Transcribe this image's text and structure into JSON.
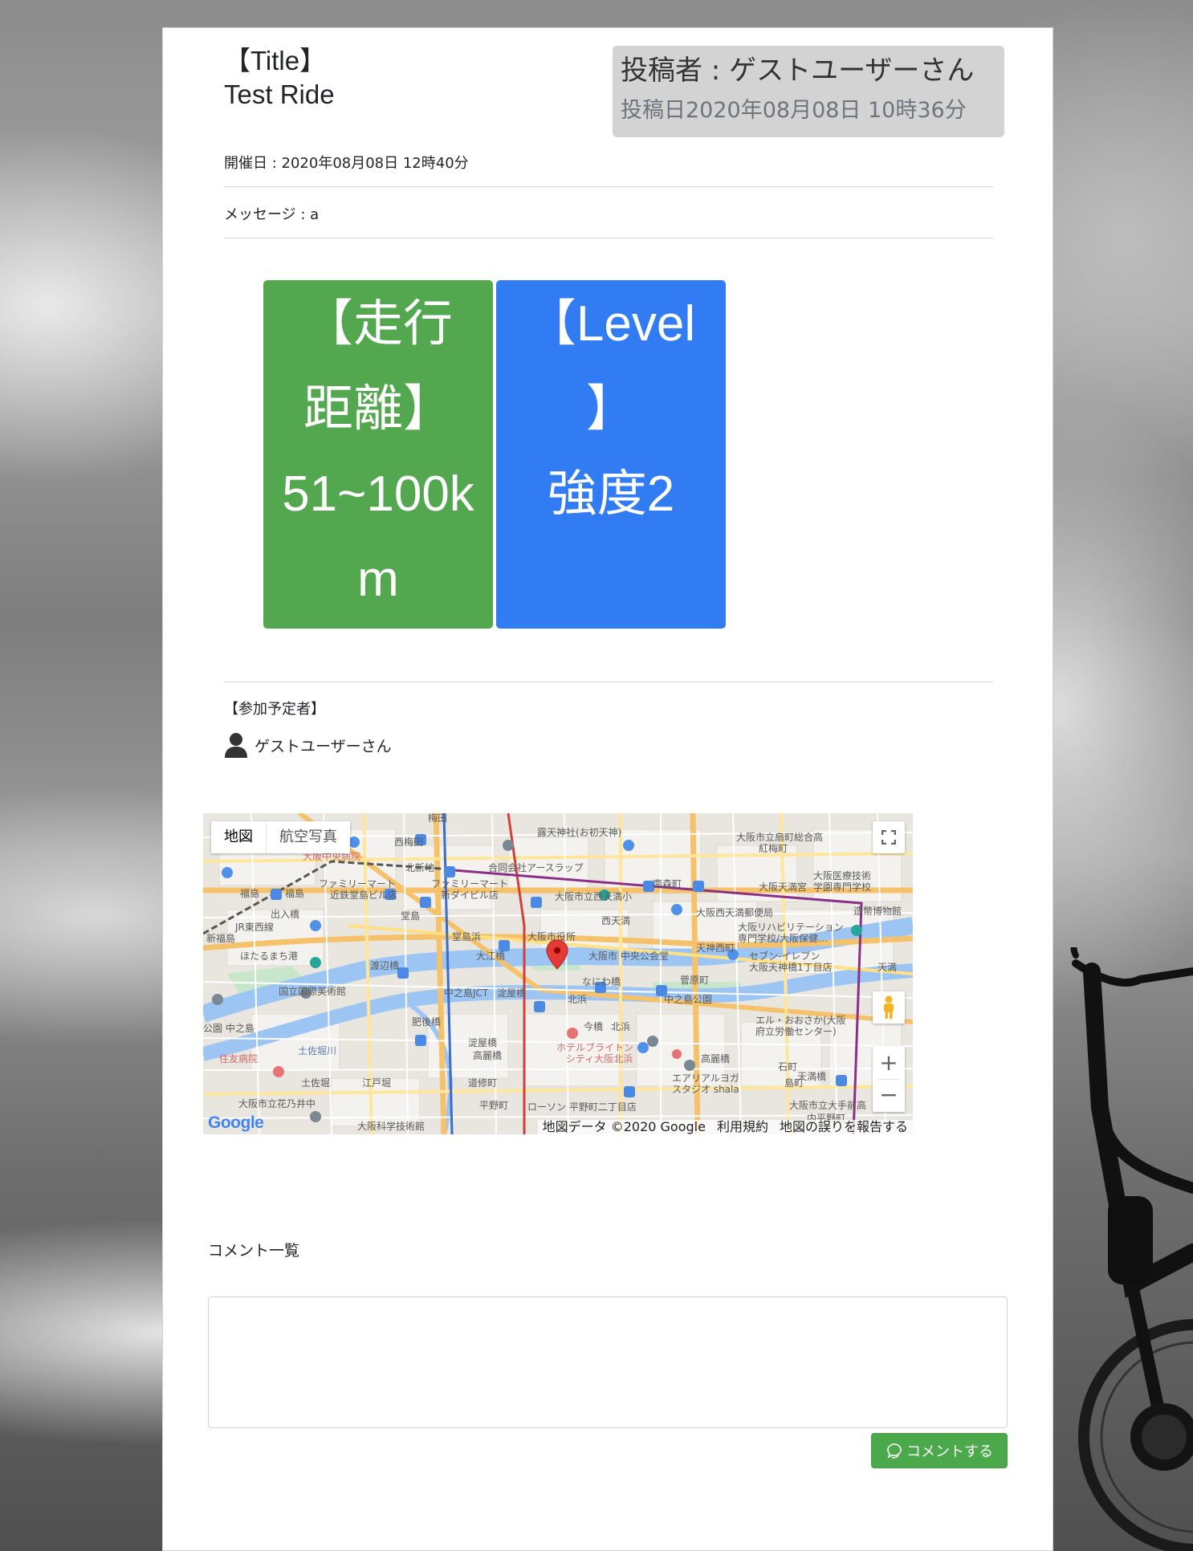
{
  "post": {
    "title_label": "【Title】",
    "title": "Test Ride",
    "author": "投稿者 : ゲストユーザーさん",
    "posted_at": "投稿日2020年08月08日 10時36分",
    "event_date": "開催日 : 2020年08月08日 12時40分",
    "message": "メッセージ : a"
  },
  "tiles": {
    "distance": {
      "line1": "【走行",
      "line2": "距離】",
      "line3": "51~100k",
      "line4": "m",
      "color": "#53a74e"
    },
    "level": {
      "line1": "【Level",
      "line2": "】",
      "line3": "強度2",
      "color": "#327cf3"
    }
  },
  "participants": {
    "heading": "【参加予定者】",
    "users": [
      "ゲストユーザーさん"
    ]
  },
  "map": {
    "type_map": "地図",
    "type_satellite": "航空写真",
    "zoom_in": "+",
    "zoom_out": "−",
    "logo": "Google",
    "attribution": "地図データ ©2020 Google",
    "terms": "利用規約",
    "report": "地図の誤りを報告する",
    "labels": [
      "梅田",
      "西梅田",
      "大阪中央病院",
      "露天神社(お初天神)",
      "大阪市立扇町総合高",
      "北新地",
      "合同会社アースラップ",
      "福島",
      "ファミリーマート 近鉄堂島ビル店",
      "ファミリーマート 新ダイビル店",
      "大阪市立西天満小",
      "南森町",
      "大阪天満宮",
      "大阪医療技術学園専門学校",
      "造幣博物館",
      "堂島",
      "大阪西天満郵便局",
      "大阪リハビリテーション専門学校/大阪保健…",
      "新福島",
      "JR東西線",
      "堂島浜",
      "大阪市役所",
      "西天満",
      "ほたるまち港",
      "大江橋",
      "大阪市 中央公会堂",
      "天神西町",
      "セブン-イレブン 大阪天神橋1丁目店",
      "天満",
      "渡辺橋",
      "なにわ橋",
      "菅原町",
      "国立国際美術館",
      "中之島JCT",
      "淀屋橋",
      "中之島公園",
      "北浜",
      "今橋",
      "エル・おおさか(大阪府立労働センター)",
      "中之島",
      "肥後橋",
      "淀屋橋",
      "高麗橋",
      "ホテルブライトンシティ大阪北浜",
      "住友病院",
      "土佐堀川",
      "土佐堀",
      "江戸堀",
      "道修町",
      "エアリアルヨガスタジオ shala",
      "石町",
      "天満橋",
      "島町",
      "大阪市立花乃井中",
      "平野町",
      "ローソン 平野町二丁目店",
      "大阪市立大手前高",
      "大阪科学技術館",
      "内平野町"
    ]
  },
  "comments": {
    "heading": "コメント一覧",
    "placeholder": "",
    "submit_label": "コメントする"
  }
}
